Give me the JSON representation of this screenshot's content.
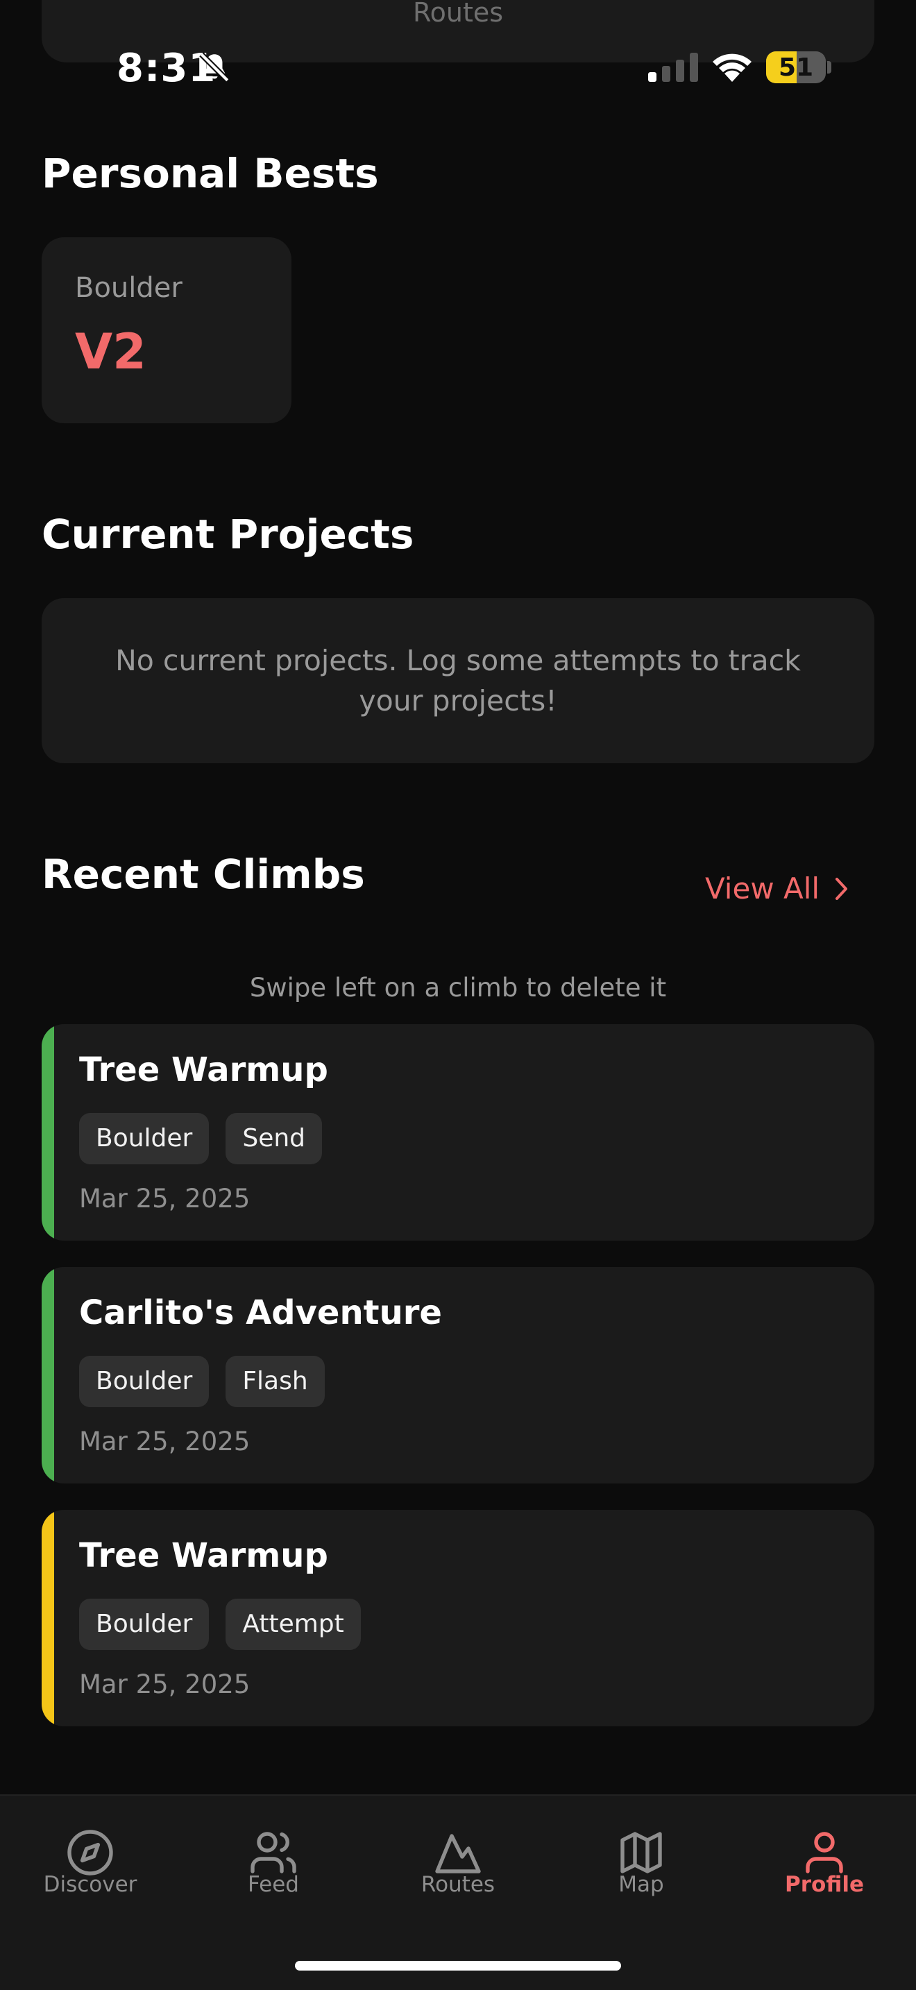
{
  "scrolled_card": {
    "label": "Routes"
  },
  "status_bar": {
    "time": "8:31",
    "battery": "51"
  },
  "colors": {
    "accent": "#f26a6a",
    "send_stripe": "#4caf50",
    "flash_stripe": "#4caf50",
    "attempt_stripe": "#f5c518"
  },
  "personal_bests": {
    "title": "Personal Bests",
    "items": [
      {
        "label": "Boulder",
        "value": "V2"
      }
    ]
  },
  "current_projects": {
    "title": "Current Projects",
    "empty_text": "No current projects. Log some attempts to track your projects!"
  },
  "recent_climbs": {
    "title": "Recent Climbs",
    "view_all": "View All",
    "hint": "Swipe left on a climb to delete it",
    "items": [
      {
        "name": "Tree Warmup",
        "tags": [
          "Boulder",
          "Send"
        ],
        "date": "Mar 25, 2025",
        "status_color": "#4caf50"
      },
      {
        "name": "Carlito's Adventure",
        "tags": [
          "Boulder",
          "Flash"
        ],
        "date": "Mar 25, 2025",
        "status_color": "#4caf50"
      },
      {
        "name": "Tree Warmup",
        "tags": [
          "Boulder",
          "Attempt"
        ],
        "date": "Mar 25, 2025",
        "status_color": "#f5c518"
      }
    ]
  },
  "tab_bar": {
    "tabs": [
      {
        "label": "Discover",
        "icon": "compass-icon"
      },
      {
        "label": "Feed",
        "icon": "users-icon"
      },
      {
        "label": "Routes",
        "icon": "mountain-icon"
      },
      {
        "label": "Map",
        "icon": "map-icon"
      },
      {
        "label": "Profile",
        "icon": "user-icon",
        "active": true
      }
    ]
  }
}
